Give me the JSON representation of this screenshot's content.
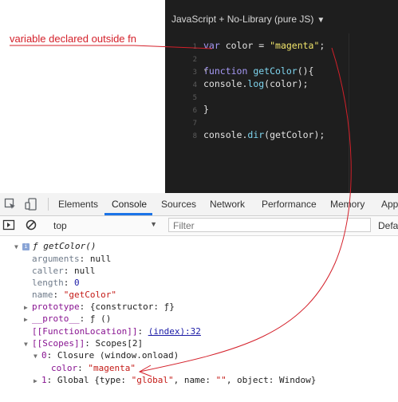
{
  "annotation": {
    "text": "variable declared outside fn",
    "color": "#d4202a"
  },
  "editor": {
    "header": "JavaScript + No-Library (pure JS)",
    "lines": [
      {
        "n": "1",
        "parts": [
          [
            "kw",
            "var "
          ],
          [
            "txt",
            "color = "
          ],
          [
            "str",
            "\"magenta\""
          ],
          [
            "txt",
            ";"
          ]
        ]
      },
      {
        "n": "2",
        "parts": []
      },
      {
        "n": "3",
        "fold": true,
        "parts": [
          [
            "kw",
            "function "
          ],
          [
            "fn",
            "getColor"
          ],
          [
            "txt",
            "(){"
          ]
        ]
      },
      {
        "n": "4",
        "parts": [
          [
            "txt",
            "console."
          ],
          [
            "fn",
            "log"
          ],
          [
            "txt",
            "(color);"
          ]
        ]
      },
      {
        "n": "5",
        "parts": []
      },
      {
        "n": "6",
        "parts": [
          [
            "txt",
            "}"
          ]
        ]
      },
      {
        "n": "7",
        "parts": []
      },
      {
        "n": "8",
        "parts": [
          [
            "txt",
            "console."
          ],
          [
            "fn",
            "dir"
          ],
          [
            "txt",
            "(getColor);"
          ]
        ]
      }
    ]
  },
  "devtools": {
    "tabs": [
      {
        "label": "Elements",
        "active": false
      },
      {
        "label": "Console",
        "active": true
      },
      {
        "label": "Sources",
        "active": false
      },
      {
        "label": "Network",
        "active": false
      },
      {
        "label": "Performance",
        "active": false
      },
      {
        "label": "Memory",
        "active": false
      },
      {
        "label": "App",
        "active": false
      }
    ],
    "toolbar": {
      "context": "top",
      "filter_placeholder": "Filter",
      "levels": "Defa"
    }
  },
  "console_rows": [
    {
      "indent": 0,
      "tri": "down",
      "badge": true,
      "parts": [
        [
          "fsig",
          "ƒ getColor()"
        ]
      ]
    },
    {
      "indent": 1,
      "parts": [
        [
          "k2",
          "arguments"
        ],
        [
          "plain",
          ": null"
        ]
      ]
    },
    {
      "indent": 1,
      "parts": [
        [
          "k2",
          "caller"
        ],
        [
          "plain",
          ": null"
        ]
      ]
    },
    {
      "indent": 1,
      "parts": [
        [
          "k2",
          "length"
        ],
        [
          "plain",
          ": "
        ],
        [
          "num",
          "0"
        ]
      ]
    },
    {
      "indent": 1,
      "parts": [
        [
          "k2",
          "name"
        ],
        [
          "plain",
          ": "
        ],
        [
          "s",
          "\"getColor\""
        ]
      ]
    },
    {
      "indent": 1,
      "tri": "right",
      "parts": [
        [
          "k",
          "prototype"
        ],
        [
          "plain",
          ": {constructor: ƒ}"
        ]
      ]
    },
    {
      "indent": 1,
      "tri": "right",
      "parts": [
        [
          "k",
          "__proto__"
        ],
        [
          "plain",
          ": ƒ ()"
        ]
      ]
    },
    {
      "indent": 1,
      "parts": [
        [
          "k",
          "[[FunctionLocation]]"
        ],
        [
          "plain",
          ": "
        ],
        [
          "link",
          "(index):32"
        ]
      ]
    },
    {
      "indent": 1,
      "tri": "down",
      "parts": [
        [
          "k",
          "[[Scopes]]"
        ],
        [
          "plain",
          ": Scopes[2]"
        ]
      ]
    },
    {
      "indent": 2,
      "tri": "down",
      "parts": [
        [
          "k",
          "0"
        ],
        [
          "plain",
          ": Closure (window.onload)"
        ]
      ]
    },
    {
      "indent": 3,
      "parts": [
        [
          "k",
          "color"
        ],
        [
          "plain",
          ": "
        ],
        [
          "s",
          "\"magenta\""
        ]
      ]
    },
    {
      "indent": 2,
      "tri": "right",
      "parts": [
        [
          "k",
          "1"
        ],
        [
          "plain",
          ": Global {type: "
        ],
        [
          "s",
          "\"global\""
        ],
        [
          "plain",
          ", name: "
        ],
        [
          "s",
          "\"\""
        ],
        [
          "plain",
          ", object: Window}"
        ]
      ]
    }
  ]
}
